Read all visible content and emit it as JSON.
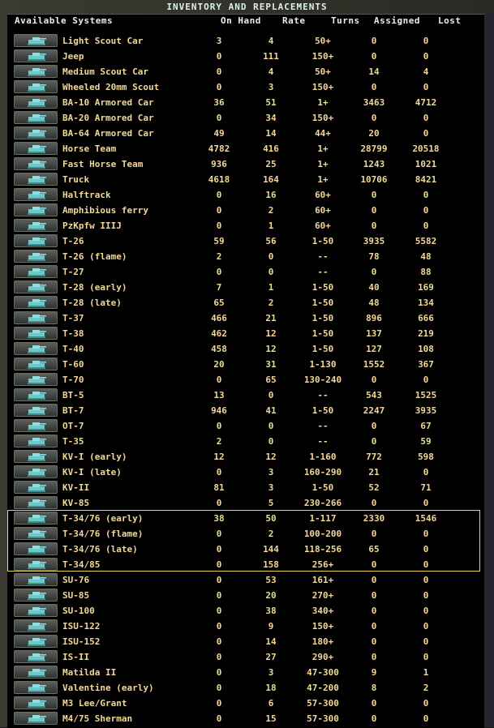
{
  "title": "INVENTORY AND REPLACEMENTS",
  "columns": [
    "Available Systems",
    "On Hand",
    "Rate",
    "Turns",
    "Assigned",
    "Lost"
  ],
  "colors": {
    "text": "#f2d898",
    "header": "#e6eef0",
    "highlight": "#e6d34a",
    "icon": "#6fc8c8"
  },
  "rows": [
    {
      "name": "Light Scout Car",
      "icon": "scout-car-icon",
      "v": [
        "3",
        "4",
        "50+",
        "0",
        "0"
      ]
    },
    {
      "name": "Jeep",
      "icon": "jeep-icon",
      "v": [
        "0",
        "111",
        "150+",
        "0",
        "0"
      ]
    },
    {
      "name": "Medium Scout Car",
      "icon": "scout-car-icon",
      "v": [
        "0",
        "4",
        "50+",
        "14",
        "4"
      ]
    },
    {
      "name": "Wheeled 20mm Scout",
      "icon": "armored-car-icon",
      "v": [
        "0",
        "3",
        "150+",
        "0",
        "0"
      ]
    },
    {
      "name": "BA-10 Armored Car",
      "icon": "armored-car-icon",
      "v": [
        "36",
        "51",
        "1+",
        "3463",
        "4712"
      ]
    },
    {
      "name": "BA-20 Armored Car",
      "icon": "armored-car-icon",
      "v": [
        "0",
        "34",
        "150+",
        "0",
        "0"
      ]
    },
    {
      "name": "BA-64 Armored Car",
      "icon": "armored-car-icon",
      "v": [
        "49",
        "14",
        "44+",
        "20",
        "0"
      ]
    },
    {
      "name": "Horse Team",
      "icon": "horse-icon",
      "v": [
        "4782",
        "416",
        "1+",
        "28799",
        "20518"
      ]
    },
    {
      "name": "Fast Horse Team",
      "icon": "horse-icon",
      "v": [
        "936",
        "25",
        "1+",
        "1243",
        "1021"
      ]
    },
    {
      "name": "Truck",
      "icon": "truck-icon",
      "v": [
        "4618",
        "164",
        "1+",
        "10706",
        "8421"
      ]
    },
    {
      "name": "Halftrack",
      "icon": "halftrack-icon",
      "v": [
        "0",
        "16",
        "60+",
        "0",
        "0"
      ]
    },
    {
      "name": "Amphibious ferry",
      "icon": "ferry-icon",
      "v": [
        "0",
        "2",
        "60+",
        "0",
        "0"
      ]
    },
    {
      "name": "PzKpfw IIIJ",
      "icon": "tank-icon",
      "v": [
        "0",
        "1",
        "60+",
        "0",
        "0"
      ]
    },
    {
      "name": "T-26",
      "icon": "tank-icon",
      "v": [
        "59",
        "56",
        "1-50",
        "3935",
        "5582"
      ]
    },
    {
      "name": "T-26 (flame)",
      "icon": "tank-icon",
      "v": [
        "2",
        "0",
        "--",
        "78",
        "48"
      ]
    },
    {
      "name": "T-27",
      "icon": "tank-icon",
      "v": [
        "0",
        "0",
        "--",
        "0",
        "88"
      ]
    },
    {
      "name": "T-28 (early)",
      "icon": "tank-icon",
      "v": [
        "7",
        "1",
        "1-50",
        "40",
        "169"
      ]
    },
    {
      "name": "T-28 (late)",
      "icon": "tank-icon",
      "v": [
        "65",
        "2",
        "1-50",
        "48",
        "134"
      ]
    },
    {
      "name": "T-37",
      "icon": "tank-icon",
      "v": [
        "466",
        "21",
        "1-50",
        "896",
        "666"
      ]
    },
    {
      "name": "T-38",
      "icon": "tank-icon",
      "v": [
        "462",
        "12",
        "1-50",
        "137",
        "219"
      ]
    },
    {
      "name": "T-40",
      "icon": "tank-icon",
      "v": [
        "458",
        "12",
        "1-50",
        "127",
        "108"
      ]
    },
    {
      "name": "T-60",
      "icon": "tank-icon",
      "v": [
        "20",
        "31",
        "1-130",
        "1552",
        "367"
      ]
    },
    {
      "name": "T-70",
      "icon": "tank-icon",
      "v": [
        "0",
        "65",
        "130-240",
        "0",
        "0"
      ]
    },
    {
      "name": "BT-5",
      "icon": "tank-icon",
      "v": [
        "13",
        "0",
        "--",
        "543",
        "1525"
      ]
    },
    {
      "name": "BT-7",
      "icon": "tank-icon",
      "v": [
        "946",
        "41",
        "1-50",
        "2247",
        "3935"
      ]
    },
    {
      "name": "OT-7",
      "icon": "tank-icon",
      "v": [
        "0",
        "0",
        "--",
        "0",
        "67"
      ]
    },
    {
      "name": "T-35",
      "icon": "tank-icon",
      "v": [
        "2",
        "0",
        "--",
        "0",
        "59"
      ]
    },
    {
      "name": "KV-I (early)",
      "icon": "tank-icon",
      "v": [
        "12",
        "12",
        "1-160",
        "772",
        "598"
      ]
    },
    {
      "name": "KV-I (late)",
      "icon": "tank-icon",
      "v": [
        "0",
        "3",
        "160-290",
        "21",
        "0"
      ]
    },
    {
      "name": "KV-II",
      "icon": "tank-icon",
      "v": [
        "81",
        "3",
        "1-50",
        "52",
        "71"
      ]
    },
    {
      "name": "KV-85",
      "icon": "tank-icon",
      "v": [
        "0",
        "5",
        "230-266",
        "0",
        "0"
      ]
    },
    {
      "name": "T-34/76 (early)",
      "icon": "tank-icon",
      "v": [
        "38",
        "50",
        "1-117",
        "2330",
        "1546"
      ]
    },
    {
      "name": "T-34/76 (flame)",
      "icon": "tank-icon",
      "v": [
        "0",
        "2",
        "100-200",
        "0",
        "0"
      ]
    },
    {
      "name": "T-34/76 (late)",
      "icon": "tank-icon",
      "v": [
        "0",
        "144",
        "118-256",
        "65",
        "0"
      ]
    },
    {
      "name": "T-34/85",
      "icon": "tank-icon",
      "v": [
        "0",
        "158",
        "256+",
        "0",
        "0"
      ]
    },
    {
      "name": "SU-76",
      "icon": "assault-gun-icon",
      "v": [
        "0",
        "53",
        "161+",
        "0",
        "0"
      ]
    },
    {
      "name": "SU-85",
      "icon": "assault-gun-icon",
      "v": [
        "0",
        "20",
        "270+",
        "0",
        "0"
      ]
    },
    {
      "name": "SU-100",
      "icon": "assault-gun-icon",
      "v": [
        "0",
        "38",
        "340+",
        "0",
        "0"
      ]
    },
    {
      "name": "ISU-122",
      "icon": "assault-gun-icon",
      "v": [
        "0",
        "9",
        "150+",
        "0",
        "0"
      ]
    },
    {
      "name": "ISU-152",
      "icon": "assault-gun-icon",
      "v": [
        "0",
        "14",
        "180+",
        "0",
        "0"
      ]
    },
    {
      "name": "IS-II",
      "icon": "tank-icon",
      "v": [
        "0",
        "27",
        "290+",
        "0",
        "0"
      ]
    },
    {
      "name": "Matilda II",
      "icon": "tank-icon",
      "v": [
        "0",
        "3",
        "47-300",
        "9",
        "1"
      ]
    },
    {
      "name": "Valentine (early)",
      "icon": "tank-icon",
      "v": [
        "0",
        "18",
        "47-200",
        "8",
        "2"
      ]
    },
    {
      "name": "M3 Lee/Grant",
      "icon": "tank-icon",
      "v": [
        "0",
        "6",
        "57-300",
        "0",
        "0"
      ]
    },
    {
      "name": "M4/75 Sherman",
      "icon": "tank-icon",
      "v": [
        "0",
        "15",
        "57-300",
        "0",
        "0"
      ]
    }
  ]
}
